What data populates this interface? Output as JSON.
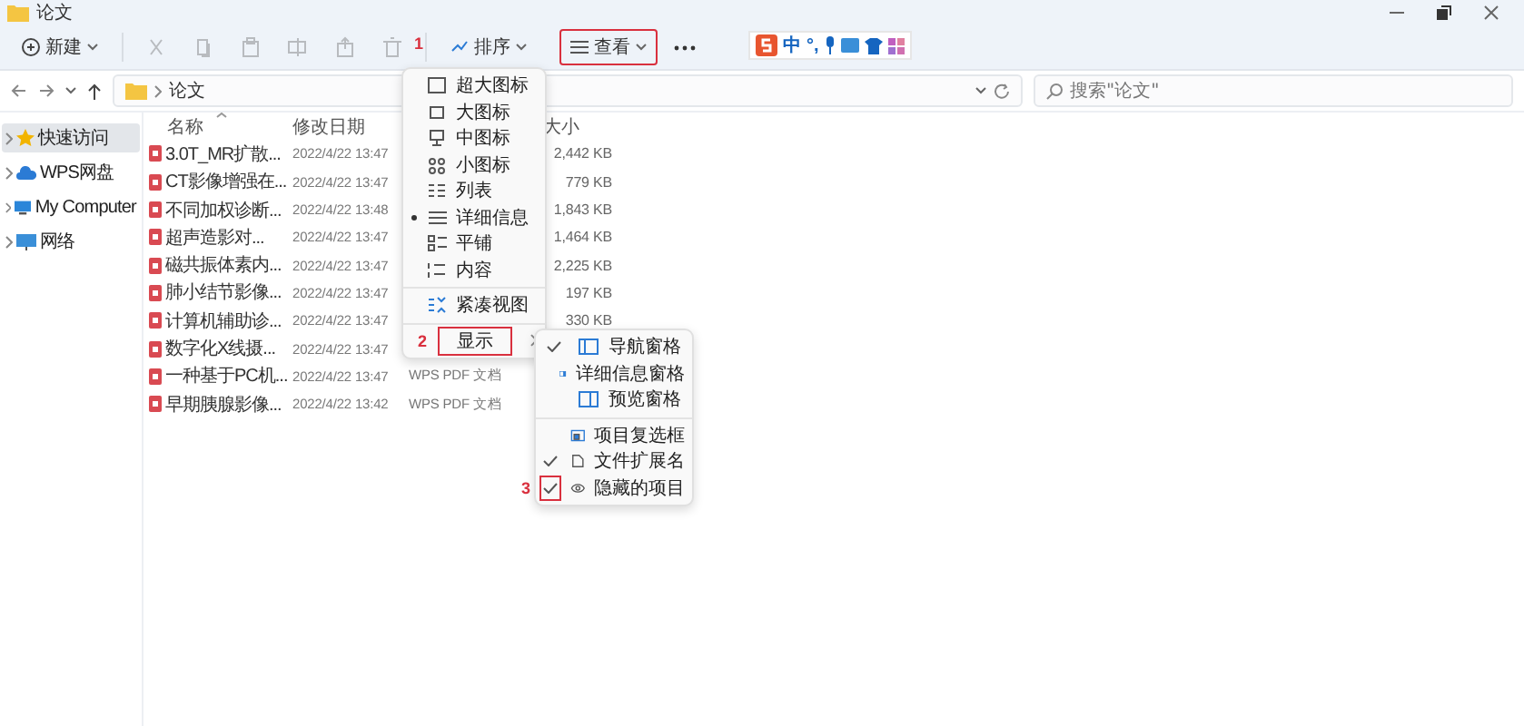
{
  "window": {
    "title": "论文"
  },
  "toolbar": {
    "new_button": {
      "label": "新建"
    },
    "edit_actions": [
      {
        "disabled": true
      },
      {
        "disabled": true
      },
      {
        "disabled": true
      },
      {
        "disabled": true
      },
      {
        "disabled": true
      },
      {
        "disabled": true
      }
    ],
    "sort_button": {
      "label": "排序"
    },
    "view_button": {
      "label": "查看",
      "highlighted": true,
      "callout": "1"
    }
  },
  "ime_bar": {
    "labels": [
      "中",
      "°,"
    ]
  },
  "address_bar": {
    "path": "论文"
  },
  "search": {
    "placeholder": "搜索\"论文\""
  },
  "sidebar": {
    "items": [
      {
        "label": "快速访问",
        "selected": true
      },
      {
        "label": "WPS网盘",
        "selected": false
      },
      {
        "label": "My Computer",
        "selected": false
      },
      {
        "label": "网络",
        "selected": false
      }
    ]
  },
  "table": {
    "columns": {
      "name": "名称",
      "modified": "修改日期",
      "size": "大小"
    },
    "rows": [
      {
        "name": "3.0T_MR扩散...",
        "modified": "2022/4/22 13:47",
        "size": "2,442 KB"
      },
      {
        "name": "CT影像增强在...",
        "modified": "2022/4/22 13:47",
        "size": "779 KB"
      },
      {
        "name": "不同加权诊断...",
        "modified": "2022/4/22 13:48",
        "size": "1,843 KB"
      },
      {
        "name": "超声造影对...",
        "modified": "2022/4/22 13:47",
        "size": "1,464 KB"
      },
      {
        "name": "磁共振体素内...",
        "modified": "2022/4/22 13:47",
        "size": "2,225 KB"
      },
      {
        "name": "肺小结节影像...",
        "modified": "2022/4/22 13:47",
        "size": "197 KB"
      },
      {
        "name": "计算机辅助诊...",
        "modified": "2022/4/22 13:47",
        "size": "330 KB"
      },
      {
        "name": "数字化X线摄...",
        "modified": "2022/4/22 13:47"
      },
      {
        "name": "一种基于PC机...",
        "modified": "2022/4/22 13:47",
        "type": "WPS PDF 文档"
      },
      {
        "name": "早期胰腺影像...",
        "modified": "2022/4/22 13:42",
        "type": "WPS PDF 文档"
      }
    ]
  },
  "view_menu": {
    "items": [
      {
        "kind": "item",
        "label": "超大图标",
        "selected": false
      },
      {
        "kind": "item",
        "label": "大图标",
        "selected": false
      },
      {
        "kind": "item",
        "label": "中图标",
        "selected": false
      },
      {
        "kind": "item",
        "label": "小图标",
        "selected": false
      },
      {
        "kind": "item",
        "label": "列表",
        "selected": false
      },
      {
        "kind": "item",
        "label": "详细信息",
        "selected": true
      },
      {
        "kind": "item",
        "label": "平铺",
        "selected": false
      },
      {
        "kind": "item",
        "label": "内容",
        "selected": false
      },
      {
        "kind": "separator"
      },
      {
        "kind": "item",
        "label": "紧凑视图",
        "selected": false
      },
      {
        "kind": "separator"
      },
      {
        "kind": "submenu",
        "label": "显示",
        "highlighted": true,
        "callout": "2"
      }
    ]
  },
  "show_submenu": {
    "items": [
      {
        "kind": "item",
        "label": "导航窗格",
        "checked": true,
        "highlighted": false
      },
      {
        "kind": "item",
        "label": "详细信息窗格",
        "checked": false,
        "highlighted": false
      },
      {
        "kind": "item",
        "label": "预览窗格",
        "checked": false,
        "highlighted": false
      },
      {
        "kind": "separator"
      },
      {
        "kind": "item",
        "label": "项目复选框",
        "checked": false,
        "highlighted": false
      },
      {
        "kind": "item",
        "label": "文件扩展名",
        "checked": true,
        "highlighted": false
      },
      {
        "kind": "item",
        "label": "隐藏的项目",
        "checked": true,
        "highlighted": true,
        "callout": "3"
      }
    ]
  }
}
